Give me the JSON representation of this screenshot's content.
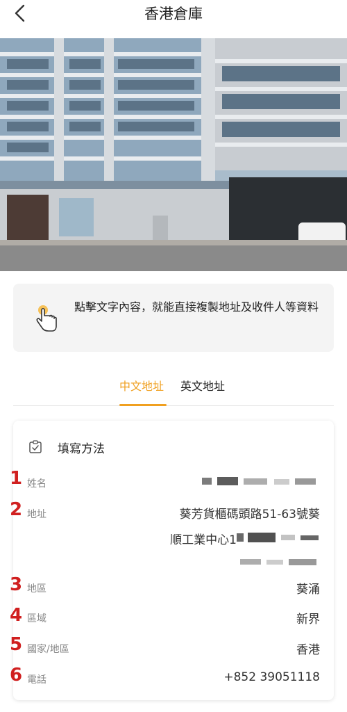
{
  "header": {
    "title": "香港倉庫"
  },
  "tip": {
    "text": "點擊文字內容，就能直接複製地址及收件人等資料"
  },
  "tabs": [
    {
      "label": "中文地址",
      "active": true
    },
    {
      "label": "英文地址",
      "active": false
    }
  ],
  "card": {
    "fill_method_label": "填寫方法",
    "rows": [
      {
        "marker": "1",
        "label": "姓名",
        "value": ""
      },
      {
        "marker": "2",
        "label": "地址",
        "value_line1": "葵芳貨櫃碼頭路51-63號葵",
        "value_line2": "順工業中心1"
      },
      {
        "marker": "3",
        "label": "地區",
        "value": "葵涌"
      },
      {
        "marker": "4",
        "label": "區域",
        "value": "新界"
      },
      {
        "marker": "5",
        "label": "國家/地區",
        "value": "香港"
      },
      {
        "marker": "6",
        "label": "電話",
        "value": "+852 39051118"
      }
    ]
  },
  "colors": {
    "accent": "#f0a020",
    "marker": "#d01f1f"
  }
}
